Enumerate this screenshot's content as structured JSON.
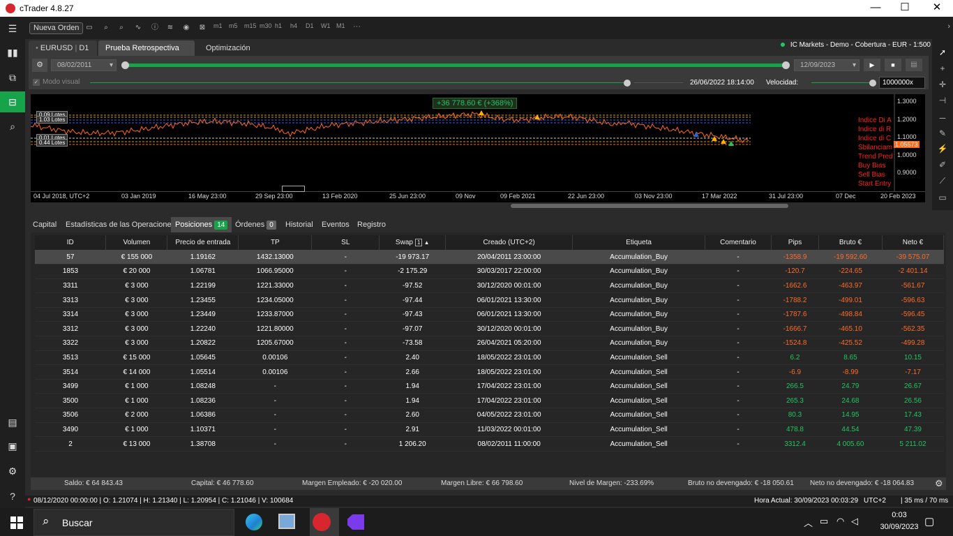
{
  "app": {
    "title": "cTrader 4.8.27"
  },
  "window_controls": {
    "minimize": "—",
    "maximize": "☐",
    "close": "✕"
  },
  "toolbar": {
    "new_order": "Nueva Orden",
    "timeframes": [
      "m1",
      "m5",
      "m15",
      "m30",
      "h1",
      "h4",
      "D1",
      "W1",
      "M1"
    ],
    "more": "···"
  },
  "account": {
    "label": "IC Markets - Demo - Cobertura - EUR - 1:500"
  },
  "tabs": [
    {
      "label": "EURUSD",
      "sub": "D1"
    },
    {
      "label": "Prueba Retrospectiva"
    },
    {
      "label": "Optimización"
    }
  ],
  "backtest": {
    "start_date": "08/02/2011",
    "end_date": "12/09/2023",
    "visual_mode": "Modo visual",
    "current_time": "26/06/2022 18:14:00",
    "speed_label": "Velocidad:",
    "speed_value": "1000000x",
    "progress": 1.0
  },
  "chart": {
    "profit_label": "+36 778.60 € (+368%)",
    "current_price": "1.05573",
    "price_ticks": [
      "1.3000",
      "1.2000",
      "1.1000",
      "1.0000",
      "0.9000"
    ],
    "time_ticks": [
      "04 Jul 2018, UTC+2",
      "03 Jan 2019",
      "16 May 23:00",
      "29 Sep 23:00",
      "13 Feb 2020",
      "25 Jun 23:00",
      "09 Nov",
      "09 Feb 2021",
      "22 Jun 23:00",
      "03 Nov 23:00",
      "17 Mar 2022",
      "31 Jul 23:00",
      "07 Dec",
      "20 Feb 2023"
    ],
    "lot_labels": [
      "0.09 Lotes",
      "1.03 Lotes",
      "0.01 Lotes",
      "0.44 Lotes"
    ],
    "indicators": [
      "Indice Di A",
      "Indice di R",
      "Indice di C",
      "Sbilanciam",
      "Trend Pred",
      "Buy Bias",
      "Sell Bias",
      "Start Entry"
    ]
  },
  "bottom_tabs": [
    {
      "label": "Capital"
    },
    {
      "label": "Estadísticas de las Operaciones"
    },
    {
      "label": "Posiciones",
      "badge": "14"
    },
    {
      "label": "Órdenes",
      "badge": "0"
    },
    {
      "label": "Historial"
    },
    {
      "label": "Eventos"
    },
    {
      "label": "Registro"
    }
  ],
  "positions": {
    "columns": [
      "ID",
      "Volumen",
      "Precio de entrada",
      "TP",
      "SL",
      "Swap",
      "Creado (UTC+2)",
      "Etiqueta",
      "Comentario",
      "Pips",
      "Bruto €",
      "Neto €"
    ],
    "swap_sort_badge": "1",
    "rows": [
      [
        "57",
        "€ 155 000",
        "1.19162",
        "1432.13000",
        "-",
        "-19 973.17",
        "20/04/2011 23:00:00",
        "Accumulation_Buy",
        "-",
        "-1358.9",
        "-19 592.60",
        "-39 575.07"
      ],
      [
        "1853",
        "€ 20 000",
        "1.06781",
        "1066.95000",
        "-",
        "-2 175.29",
        "30/03/2017 22:00:00",
        "Accumulation_Buy",
        "-",
        "-120.7",
        "-224.65",
        "-2 401.14"
      ],
      [
        "3311",
        "€ 3 000",
        "1.22199",
        "1221.33000",
        "-",
        "-97.52",
        "30/12/2020 00:01:00",
        "Accumulation_Buy",
        "-",
        "-1662.6",
        "-463.97",
        "-561.67"
      ],
      [
        "3313",
        "€ 3 000",
        "1.23455",
        "1234.05000",
        "-",
        "-97.44",
        "06/01/2021 13:30:00",
        "Accumulation_Buy",
        "-",
        "-1788.2",
        "-499.01",
        "-596.63"
      ],
      [
        "3314",
        "€ 3 000",
        "1.23449",
        "1233.87000",
        "-",
        "-97.43",
        "06/01/2021 13:30:00",
        "Accumulation_Buy",
        "-",
        "-1787.6",
        "-498.84",
        "-596.45"
      ],
      [
        "3312",
        "€ 3 000",
        "1.22240",
        "1221.80000",
        "-",
        "-97.07",
        "30/12/2020 00:01:00",
        "Accumulation_Buy",
        "-",
        "-1666.7",
        "-465.10",
        "-562.35"
      ],
      [
        "3322",
        "€ 3 000",
        "1.20822",
        "1205.67000",
        "-",
        "-73.58",
        "26/04/2021 05:20:00",
        "Accumulation_Buy",
        "-",
        "-1524.8",
        "-425.52",
        "-499.28"
      ],
      [
        "3513",
        "€ 15 000",
        "1.05645",
        "0.00106",
        "-",
        "2.40",
        "18/05/2022 23:01:00",
        "Accumulation_Sell",
        "-",
        "6.2",
        "8.65",
        "10.15"
      ],
      [
        "3514",
        "€ 14 000",
        "1.05514",
        "0.00106",
        "-",
        "2.66",
        "18/05/2022 23:01:00",
        "Accumulation_Sell",
        "-",
        "-6.9",
        "-8.99",
        "-7.17"
      ],
      [
        "3499",
        "€ 1 000",
        "1.08248",
        "-",
        "-",
        "1.94",
        "17/04/2022 23:01:00",
        "Accumulation_Sell",
        "-",
        "266.5",
        "24.79",
        "26.67"
      ],
      [
        "3500",
        "€ 1 000",
        "1.08236",
        "-",
        "-",
        "1.94",
        "17/04/2022 23:01:00",
        "Accumulation_Sell",
        "-",
        "265.3",
        "24.68",
        "26.56"
      ],
      [
        "3506",
        "€ 2 000",
        "1.06386",
        "-",
        "-",
        "2.60",
        "04/05/2022 23:01:00",
        "Accumulation_Sell",
        "-",
        "80.3",
        "14.95",
        "17.43"
      ],
      [
        "3490",
        "€ 1 000",
        "1.10371",
        "-",
        "-",
        "2.91",
        "11/03/2022 00:01:00",
        "Accumulation_Sell",
        "-",
        "478.8",
        "44.54",
        "47.39"
      ],
      [
        "2",
        "€ 13 000",
        "1.38708",
        "-",
        "-",
        "1 206.20",
        "08/02/2011 11:00:00",
        "Accumulation_Sell",
        "-",
        "3312.4",
        "4 005.60",
        "5 211.02"
      ]
    ]
  },
  "summary": {
    "saldo": "Saldo: € 64 843.43",
    "capital": "Capital: € 46 778.60",
    "margen_empleado": "Margen Empleado: € -20 020.00",
    "margen_libre": "Margen Libre: € 66 798.60",
    "nivel_margen": "Nivel de Margen: -233.69%",
    "bruto": "Bruto no devengado: € -18 050.61",
    "neto": "Neto no devengado: € -18 064.83"
  },
  "status": {
    "ohlc": "08/12/2020 00:00:00 | O: 1.21074 | H: 1.21340 | L: 1.20954 | C: 1.21046 | V: 100684",
    "hora": "Hora Actual: 30/09/2023 00:03:29",
    "tz": "UTC+2",
    "latency": "| 35 ms / 70 ms"
  },
  "taskbar": {
    "search": "Buscar",
    "time": "0:03",
    "date": "30/09/2023"
  },
  "colors": {
    "accent": "#16a34a",
    "negative": "#ff6b2b",
    "positive": "#22c55e",
    "brand": "#d7262e"
  }
}
